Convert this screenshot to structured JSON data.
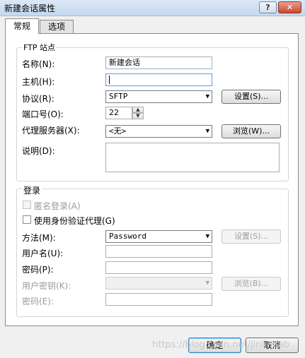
{
  "window": {
    "title": "新建会话属性",
    "help_label": "?",
    "close_label": "✕"
  },
  "tabs": [
    {
      "label": "常规",
      "selected": true
    },
    {
      "label": "选项",
      "selected": false
    }
  ],
  "ftp_site": {
    "legend": "FTP 站点",
    "name_label": "名称(N):",
    "name_value": "新建会话",
    "host_label": "主机(H):",
    "host_value": "",
    "protocol_label": "协议(R):",
    "protocol_value": "SFTP",
    "protocol_settings_label": "设置(S)...",
    "port_label": "端口号(O):",
    "port_value": "22",
    "proxy_label": "代理服务器(X):",
    "proxy_value": "<无>",
    "proxy_browse_label": "浏览(W)...",
    "description_label": "说明(D):",
    "description_value": ""
  },
  "login": {
    "legend": "登录",
    "anonymous_label": "匿名登录(A)",
    "anonymous_checked": false,
    "anonymous_enabled": false,
    "agent_label": "使用身份验证代理(G)",
    "agent_checked": false,
    "method_label": "方法(M):",
    "method_value": "Password",
    "method_settings_label": "设置(S)...",
    "username_label": "用户名(U):",
    "username_value": "",
    "password_label": "密码(P):",
    "password_value": "",
    "user_key_label": "用户密钥(K):",
    "user_key_value": "",
    "user_key_browse_label": "浏览(B)...",
    "passphrase_label": "密码(E):",
    "passphrase_value": ""
  },
  "footer": {
    "ok_label": "确定",
    "cancel_label": "取消"
  },
  "watermark": "https://blog.csdn.net/jinlinaab"
}
